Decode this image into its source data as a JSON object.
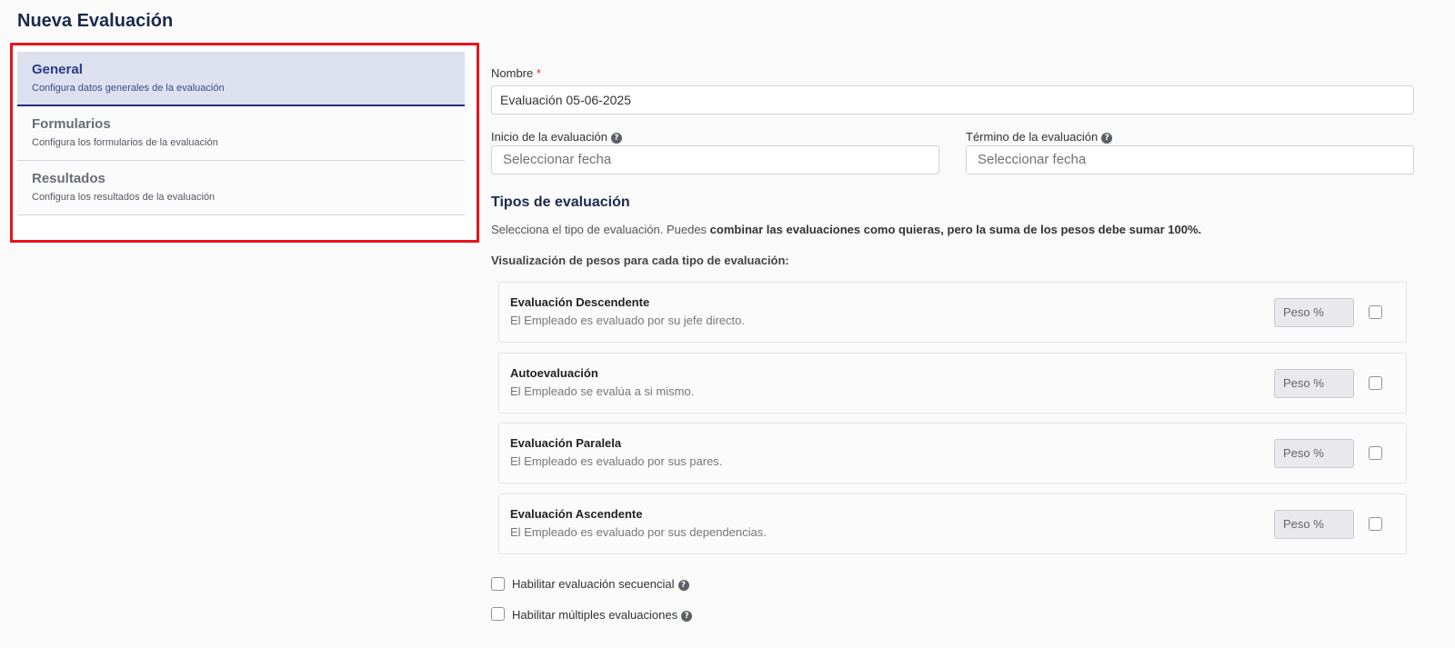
{
  "page": {
    "title": "Nueva Evaluación"
  },
  "steps": [
    {
      "title": "General",
      "subtitle": "Configura datos generales de la evaluación",
      "active": true
    },
    {
      "title": "Formularios",
      "subtitle": "Configura los formularios de la evaluación",
      "active": false
    },
    {
      "title": "Resultados",
      "subtitle": "Configura los resultados de la evaluación",
      "active": false
    }
  ],
  "form": {
    "name_label": "Nombre",
    "required_mark": "*",
    "name_value": "Evaluación 05-06-2025",
    "start_label": "Inicio de la evaluación",
    "start_placeholder": "Seleccionar fecha",
    "end_label": "Término de la evaluación",
    "end_placeholder": "Seleccionar fecha",
    "help_glyph": "?"
  },
  "types": {
    "title": "Tipos de evaluación",
    "desc_plain": "Selecciona el tipo de evaluación. Puedes ",
    "desc_bold": "combinar las evaluaciones como quieras, pero la suma de los pesos debe sumar 100%.",
    "viz_label": "Visualización de pesos para cada tipo de evaluación:",
    "items": [
      {
        "title": "Evaluación Descendente",
        "subtitle": "El Empleado es evaluado por su jefe directo.",
        "weight_placeholder": "Peso %"
      },
      {
        "title": "Autoevaluación",
        "subtitle": "El Empleado se evalúa a si mismo.",
        "weight_placeholder": "Peso %"
      },
      {
        "title": "Evaluación Paralela",
        "subtitle": "El Empleado es evaluado por sus pares.",
        "weight_placeholder": "Peso %"
      },
      {
        "title": "Evaluación Ascendente",
        "subtitle": "El Empleado es evaluado por sus dependencias.",
        "weight_placeholder": "Peso %"
      }
    ]
  },
  "options": {
    "sequential_label": "Habilitar evaluación secuencial",
    "multiple_label": "Habilitar múltiples evaluaciones"
  },
  "colors": {
    "accent": "#283b8a",
    "highlight_frame": "#e8141b",
    "active_step_bg": "#dde0ef"
  }
}
